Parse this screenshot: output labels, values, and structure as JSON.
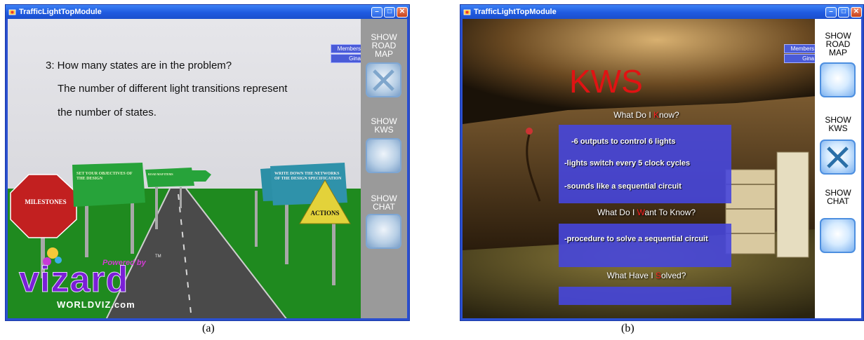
{
  "window_a": {
    "title": "TrafficLightTopModule",
    "question_title": "3: How many states are in the problem?",
    "answer_line1": "The number of different light transitions represent",
    "answer_line2": "the number of states.",
    "members_label": "Members",
    "member_name": "Gina",
    "sign_milestones": "MILESTONES",
    "sign_objectives": "SET YOUR OBJECTIVES OF THE DESIGN",
    "sign_small": "ROAD MAP ITEMS",
    "sign_networks": "WRITE DOWN THE NETWORKS OF THE DESIGN SPECIFICATION",
    "sign_actions": "ACTIONS",
    "logo_powered": "Powered by",
    "logo_tm": "TM",
    "logo_brand": "vizard",
    "logo_site": "WORLDVIZ.com",
    "sidebar": [
      {
        "label": "SHOW ROAD MAP",
        "state": "active"
      },
      {
        "label": "SHOW KWS",
        "state": "inactive"
      },
      {
        "label": "SHOW CHAT",
        "state": "inactive"
      }
    ]
  },
  "window_b": {
    "title": "TrafficLightTopModule",
    "kws_title": "KWS",
    "members_label": "Members",
    "member_name": "Gina",
    "q1_pre": "What Do I ",
    "q1_hl": "K",
    "q1_post": "now?",
    "know_items": [
      "-6 outputs to control 6 lights",
      "-lights switch every 5 clock cycles",
      "-sounds like a sequential circuit"
    ],
    "q2_pre": "What Do I ",
    "q2_hl": "W",
    "q2_post": "ant To Know?",
    "want_item": "-procedure to solve a sequential circuit",
    "q3_pre": "What Have I ",
    "q3_hl": "S",
    "q3_post": "olved?",
    "sidebar": [
      {
        "label": "SHOW ROAD MAP",
        "state": "inactive"
      },
      {
        "label": "SHOW KWS",
        "state": "active"
      },
      {
        "label": "SHOW CHAT",
        "state": "inactive"
      }
    ]
  },
  "captions": {
    "a": "(a)",
    "b": "(b)"
  },
  "colors": {
    "titlebar": "#1f5ae0",
    "kws_red": "#e01313",
    "panel_blue": "#4646dc"
  }
}
